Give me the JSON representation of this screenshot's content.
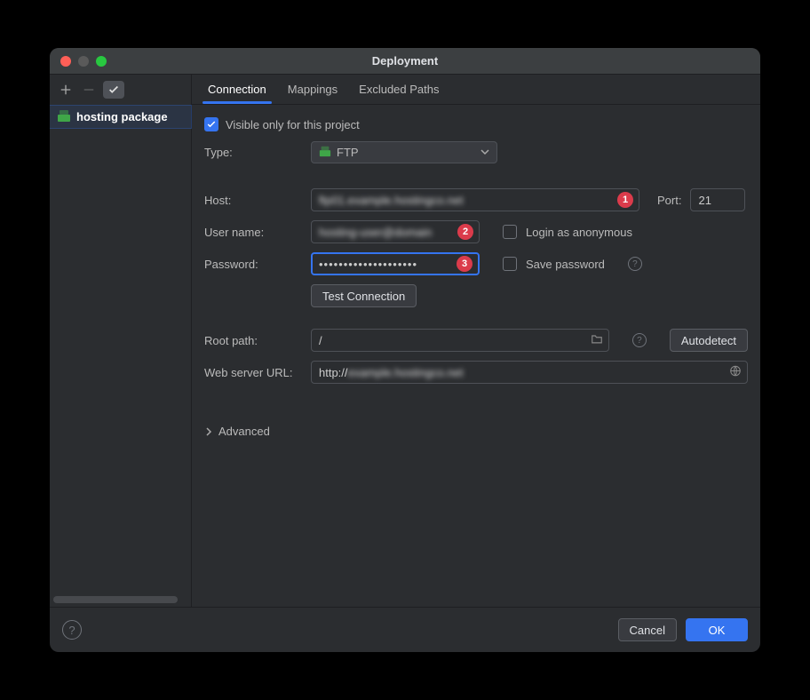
{
  "window": {
    "title": "Deployment"
  },
  "sidebar": {
    "items": [
      {
        "label": "hosting package"
      }
    ]
  },
  "tabs": {
    "connection": "Connection",
    "mappings": "Mappings",
    "excluded": "Excluded Paths"
  },
  "form": {
    "visible_only_label": "Visible only for this project",
    "visible_only_checked": true,
    "type_label": "Type:",
    "type_value": "FTP",
    "host_label": "Host:",
    "host_value": "redacted",
    "host_badge": "1",
    "port_label": "Port:",
    "port_value": "21",
    "user_label": "User name:",
    "user_value": "redacted",
    "user_badge": "2",
    "anon_label": "Login as anonymous",
    "pass_label": "Password:",
    "pass_value": "••••••••••••••••••••",
    "pass_badge": "3",
    "save_pass_label": "Save password",
    "test_btn": "Test Connection",
    "root_label": "Root path:",
    "root_value": "/",
    "autodetect_btn": "Autodetect",
    "weburl_label": "Web server URL:",
    "weburl_prefix": "http://",
    "weburl_host": "redacted",
    "advanced_label": "Advanced"
  },
  "footer": {
    "cancel": "Cancel",
    "ok": "OK"
  }
}
